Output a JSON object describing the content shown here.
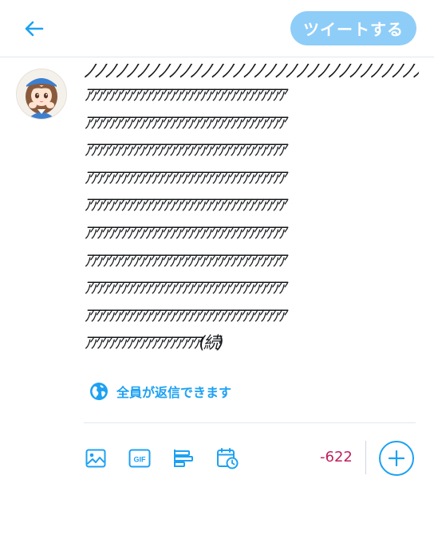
{
  "header": {
    "tweet_button_label": "ツイートする"
  },
  "compose": {
    "lines": [
      "ﾉﾉﾉﾉﾉﾉﾉﾉﾉﾉﾉﾉﾉﾉﾉﾉﾉﾉﾉﾉﾉﾉﾉﾉﾉﾉﾉﾉﾉﾉﾉﾉ",
      "ｱｱｱｱｱｱｱｱｱｱｱｱｱｱｱｱｱｱｱｱｱｱｱｱｱｱｱｱｱｱｱｱｱ",
      "ｱｱｱｱｱｱｱｱｱｱｱｱｱｱｱｱｱｱｱｱｱｱｱｱｱｱｱｱｱｱｱｱｱ",
      "ｱｱｱｱｱｱｱｱｱｱｱｱｱｱｱｱｱｱｱｱｱｱｱｱｱｱｱｱｱｱｱｱｱ",
      "ｱｱｱｱｱｱｱｱｱｱｱｱｱｱｱｱｱｱｱｱｱｱｱｱｱｱｱｱｱｱｱｱｱ",
      "ｱｱｱｱｱｱｱｱｱｱｱｱｱｱｱｱｱｱｱｱｱｱｱｱｱｱｱｱｱｱｱｱｱ",
      "ｱｱｱｱｱｱｱｱｱｱｱｱｱｱｱｱｱｱｱｱｱｱｱｱｱｱｱｱｱｱｱｱｱ",
      "ｱｱｱｱｱｱｱｱｱｱｱｱｱｱｱｱｱｱｱｱｱｱｱｱｱｱｱｱｱｱｱｱｱ",
      "ｱｱｱｱｱｱｱｱｱｱｱｱｱｱｱｱｱｱｱｱｱｱｱｱｱｱｱｱｱｱｱｱｱ",
      "ｱｱｱｱｱｱｱｱｱｱｱｱｱｱｱｱｱｱｱｱｱｱｱｱｱｱｱｱｱｱｱｱｱ",
      "ｱｱｱｱｱｱｱｱｱｱｱｱｱｱｱｱｱｱｱ(続)"
    ]
  },
  "reply_setting": {
    "label": "全員が返信できます"
  },
  "toolbar": {
    "counter": "-622"
  },
  "icons": {
    "back": "arrow-left-icon",
    "globe": "globe-icon",
    "image": "image-icon",
    "gif": "gif-icon",
    "poll": "poll-icon",
    "schedule": "schedule-icon",
    "add": "plus-icon"
  },
  "colors": {
    "accent": "#1da1f2",
    "button_disabled": "#8ecdf8",
    "counter_over": "#c0205b"
  }
}
